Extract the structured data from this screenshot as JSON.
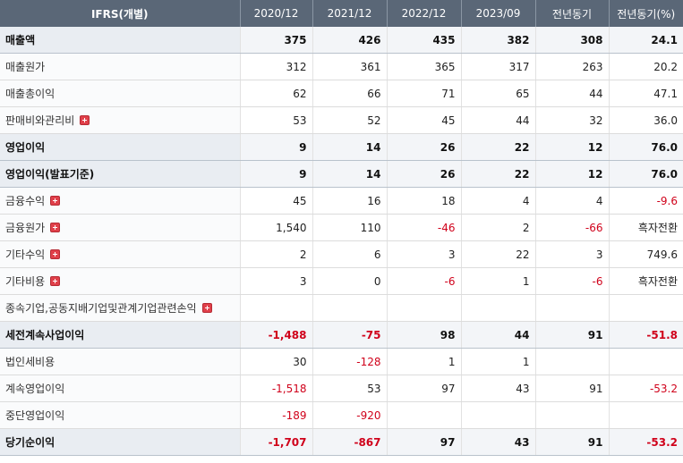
{
  "headers": [
    "IFRS(개별)",
    "2020/12",
    "2021/12",
    "2022/12",
    "2023/09",
    "전년동기",
    "전년동기(%)"
  ],
  "rows": [
    {
      "label": "매출액",
      "bold": true,
      "expand": false,
      "values": [
        "375",
        "426",
        "435",
        "382",
        "308",
        "24.1"
      ]
    },
    {
      "label": "매출원가",
      "bold": false,
      "expand": false,
      "values": [
        "312",
        "361",
        "365",
        "317",
        "263",
        "20.2"
      ]
    },
    {
      "label": "매출총이익",
      "bold": false,
      "expand": false,
      "values": [
        "62",
        "66",
        "71",
        "65",
        "44",
        "47.1"
      ]
    },
    {
      "label": "판매비와관리비",
      "bold": false,
      "expand": true,
      "values": [
        "53",
        "52",
        "45",
        "44",
        "32",
        "36.0"
      ]
    },
    {
      "label": "영업이익",
      "bold": true,
      "expand": false,
      "values": [
        "9",
        "14",
        "26",
        "22",
        "12",
        "76.0"
      ]
    },
    {
      "label": "영업이익(발표기준)",
      "bold": true,
      "expand": false,
      "values": [
        "9",
        "14",
        "26",
        "22",
        "12",
        "76.0"
      ]
    },
    {
      "label": "금융수익",
      "bold": false,
      "expand": true,
      "values": [
        "45",
        "16",
        "18",
        "4",
        "4",
        "-9.6"
      ]
    },
    {
      "label": "금융원가",
      "bold": false,
      "expand": true,
      "values": [
        "1,540",
        "110",
        "-46",
        "2",
        "-66",
        "흑자전환"
      ]
    },
    {
      "label": "기타수익",
      "bold": false,
      "expand": true,
      "values": [
        "2",
        "6",
        "3",
        "22",
        "3",
        "749.6"
      ]
    },
    {
      "label": "기타비용",
      "bold": false,
      "expand": true,
      "values": [
        "3",
        "0",
        "-6",
        "1",
        "-6",
        "흑자전환"
      ]
    },
    {
      "label": "종속기업,공동지배기업및관계기업관련손익",
      "bold": false,
      "expand": true,
      "values": [
        "",
        "",
        "",
        "",
        "",
        ""
      ]
    },
    {
      "label": "세전계속사업이익",
      "bold": true,
      "expand": false,
      "values": [
        "-1,488",
        "-75",
        "98",
        "44",
        "91",
        "-51.8"
      ]
    },
    {
      "label": "법인세비용",
      "bold": false,
      "expand": false,
      "values": [
        "30",
        "-128",
        "1",
        "1",
        "",
        ""
      ]
    },
    {
      "label": "계속영업이익",
      "bold": false,
      "expand": false,
      "values": [
        "-1,518",
        "53",
        "97",
        "43",
        "91",
        "-53.2"
      ]
    },
    {
      "label": "중단영업이익",
      "bold": false,
      "expand": false,
      "values": [
        "-189",
        "-920",
        "",
        "",
        "",
        ""
      ]
    },
    {
      "label": "당기순이익",
      "bold": true,
      "expand": false,
      "values": [
        "-1,707",
        "-867",
        "97",
        "43",
        "91",
        "-53.2"
      ]
    }
  ]
}
